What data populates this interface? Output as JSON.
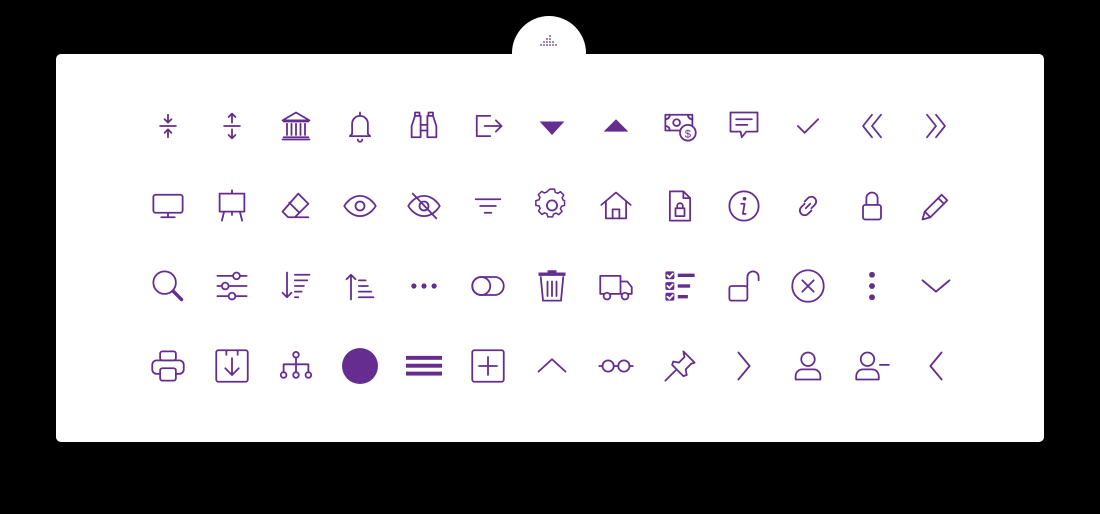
{
  "colors": {
    "accent": "#652d90",
    "card": "#ffffff",
    "background": "#000000"
  },
  "logo": "equalizer-logo",
  "rows": [
    [
      "compress-vertical-icon",
      "expand-vertical-icon",
      "bank-icon",
      "bell-icon",
      "binoculars-icon",
      "sign-out-icon",
      "caret-down-icon",
      "caret-up-icon",
      "money-bill-icon",
      "comment-icon",
      "check-icon",
      "double-chevron-left-icon",
      "double-chevron-right-icon"
    ],
    [
      "monitor-icon",
      "easel-icon",
      "eraser-icon",
      "eye-icon",
      "eye-slash-icon",
      "filter-icon",
      "gear-icon",
      "home-icon",
      "file-lock-icon",
      "info-icon",
      "link-icon",
      "lock-icon",
      "pencil-icon"
    ],
    [
      "search-icon",
      "sliders-icon",
      "sort-down-icon",
      "sort-up-icon",
      "ellipsis-icon",
      "toggle-icon",
      "trash-icon",
      "truck-icon",
      "checklist-icon",
      "unlock-icon",
      "circle-x-icon",
      "more-vertical-icon",
      "chevron-down-icon"
    ],
    [
      "printer-icon",
      "download-box-icon",
      "hierarchy-icon",
      "filled-circle-icon",
      "bars-icon",
      "plus-square-icon",
      "chevron-up-icon",
      "glasses-icon",
      "pin-icon",
      "chevron-right-icon",
      "user-icon",
      "user-minus-icon",
      "chevron-left-icon"
    ]
  ]
}
